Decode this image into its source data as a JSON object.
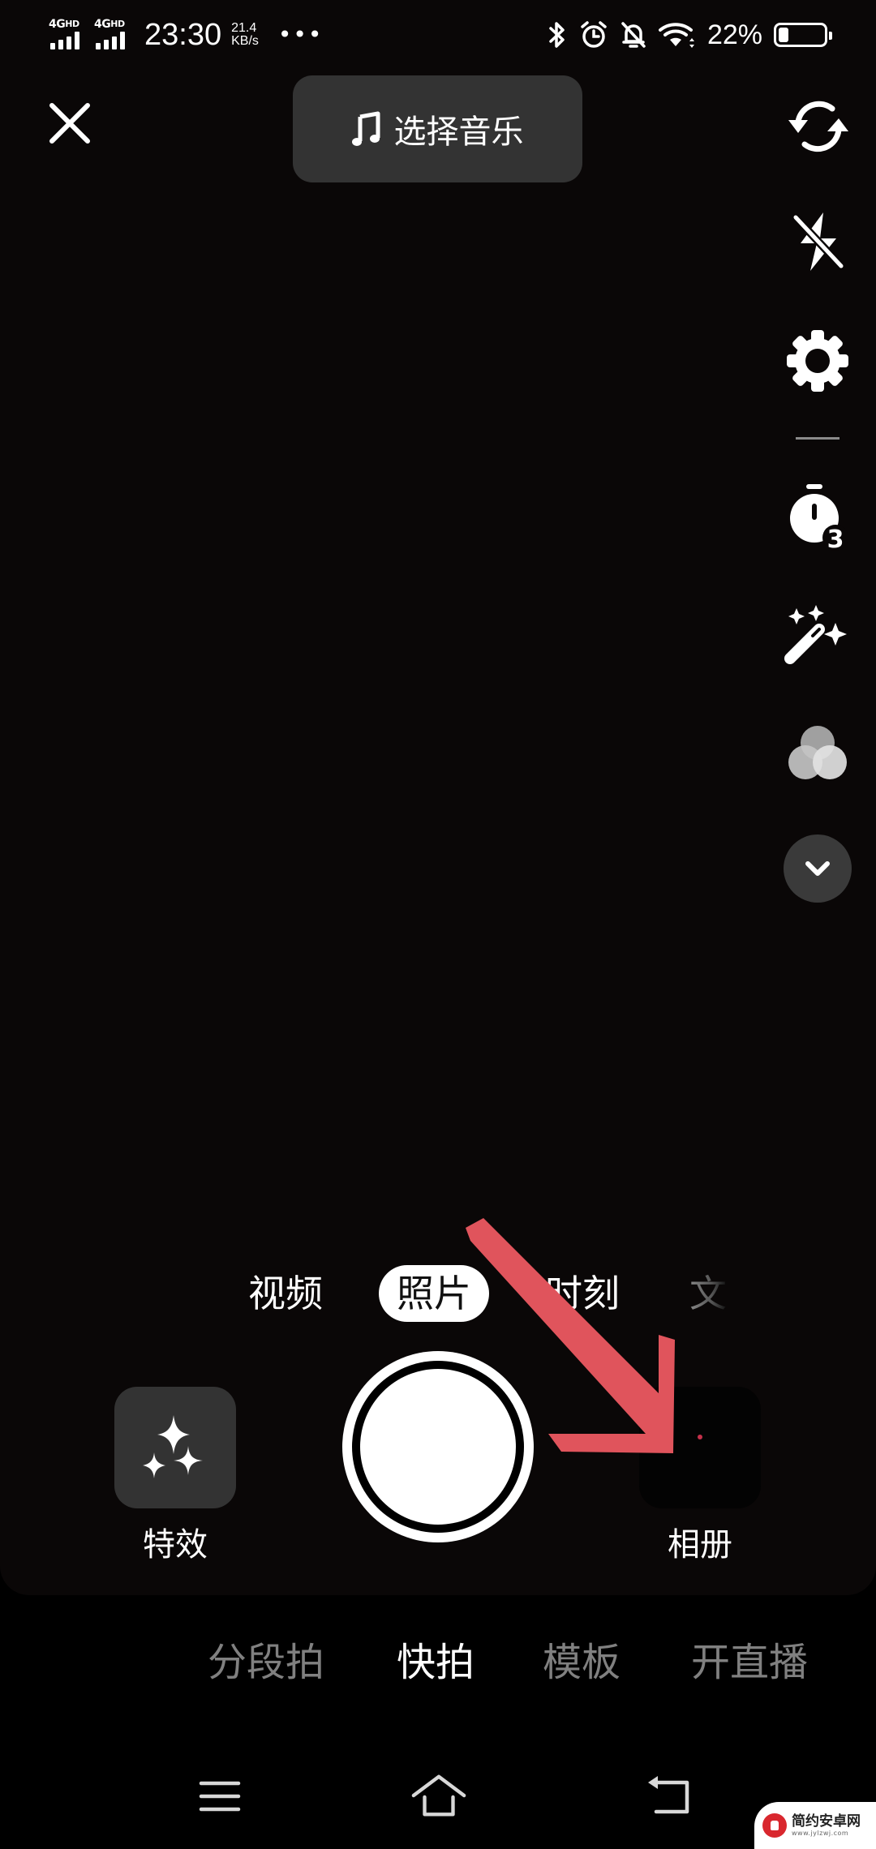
{
  "status_bar": {
    "sim1": {
      "network": "4G",
      "badge": "HD",
      "signal_bars": 4
    },
    "sim2": {
      "network": "4G",
      "badge": "HD",
      "signal_bars": 4
    },
    "time": "23:30",
    "net_speed_value": "21.4",
    "net_speed_unit": "KB/s",
    "more_indicator": "•••",
    "icons": [
      "bluetooth-icon",
      "alarm-icon",
      "bell-muted-icon",
      "wifi-icon"
    ],
    "battery_percent_label": "22%",
    "battery_level": 0.22
  },
  "top_bar": {
    "close_icon": "close-icon",
    "music_button_icon": "music-note-icon",
    "music_button_label": "选择音乐"
  },
  "right_toolbar": {
    "items": [
      {
        "name": "flip-camera",
        "icon": "flip-camera-icon"
      },
      {
        "name": "flash-off",
        "icon": "flash-off-icon"
      },
      {
        "name": "settings",
        "icon": "gear-icon"
      },
      {
        "name": "timer",
        "icon": "timer-icon",
        "badge": "3"
      },
      {
        "name": "beautify",
        "icon": "magic-wand-icon"
      },
      {
        "name": "filters",
        "icon": "filter-circles-icon"
      },
      {
        "name": "more",
        "icon": "chevron-down-icon"
      }
    ]
  },
  "capture_modes": {
    "items": [
      {
        "label": "视频",
        "active": false
      },
      {
        "label": "照片",
        "active": true
      },
      {
        "label": "时刻",
        "active": false
      },
      {
        "label": "文",
        "active": false,
        "faded": true
      }
    ]
  },
  "capture_row": {
    "effects_label": "特效",
    "effects_icon": "sparkles-icon",
    "shutter": "shutter-button",
    "album_label": "相册"
  },
  "annotation": {
    "arrow_color": "#e0545c",
    "points_to": "album-button"
  },
  "app_tabs": {
    "items": [
      {
        "label": "分段拍",
        "active": false
      },
      {
        "label": "快拍",
        "active": true
      },
      {
        "label": "模板",
        "active": false
      },
      {
        "label": "开直播",
        "active": false
      }
    ]
  },
  "nav_bar": {
    "items": [
      "menu-icon",
      "home-icon",
      "back-icon"
    ]
  },
  "watermark": {
    "title": "简约安卓网",
    "url": "www.jylzwj.com"
  },
  "colors": {
    "background": "#000000",
    "preview": "#0a0707",
    "pill": "#333333",
    "inactive_text": "#808080",
    "active_text": "#ffffff",
    "arrow": "#e0545c"
  }
}
